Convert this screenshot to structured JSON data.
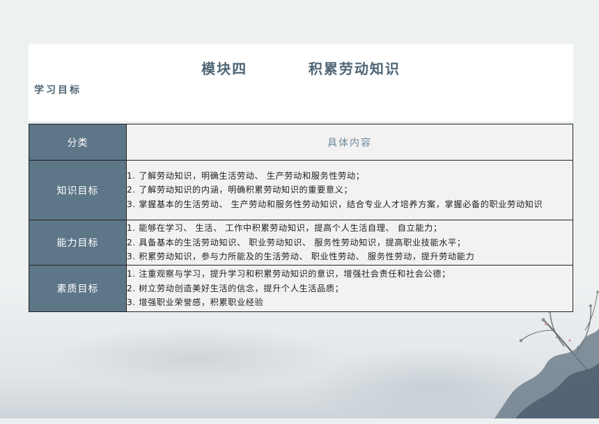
{
  "page": {
    "title": "模块四        积累劳动知识",
    "subtitle": "学习目标"
  },
  "table": {
    "header": {
      "category": "分类",
      "content": "具体内容"
    },
    "rows": [
      {
        "category": "知识目标",
        "items": [
          "1. 了解劳动知识，明确生活劳动、 生产劳动和服务性劳动；",
          "2. 了解劳动知识的内涵，明确积累劳动知识的重要意义；",
          "3. 掌握基本的生活劳动、 生产劳动和服务性劳动知识，结合专业人才培养方案，掌握必备的职业劳动知识"
        ]
      },
      {
        "category": "能力目标",
        "items": [
          "1. 能够在学习、 生活、 工作中积累劳动知识，提高个人生活自理、 自立能力；",
          "2. 具备基本的生活劳动知识、 职业劳动知识、 服务性劳动知识，提高职业技能水平；",
          "3. 积累劳动知识，参与力所能及的生活劳动、 职业性劳动、 服务性劳动，提升劳动能力"
        ]
      },
      {
        "category": "素质目标",
        "items": [
          "1. 注重观察与学习，提升学习和积累劳动知识的意识，增强社会责任和社会公德；",
          "2. 树立劳动创造美好生活的信念，提升个人生活品质；",
          "3. 增强职业荣誉感，积累职业经验"
        ]
      }
    ]
  },
  "decor": {
    "accent_color": "#5d7688",
    "background": "#eef1f2",
    "icons": [
      "plum-branch-illustration",
      "ink-mountain-illustration"
    ]
  }
}
